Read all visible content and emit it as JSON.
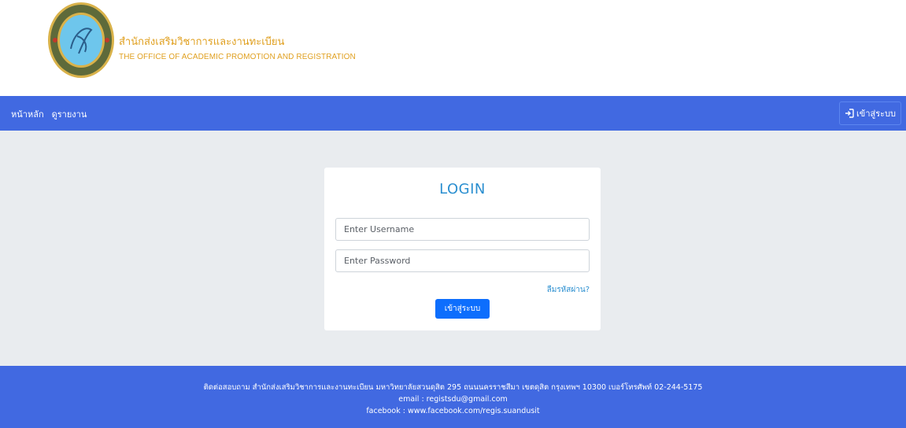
{
  "header": {
    "brand_th": "สำนักส่งเสริมวิชาการและงานทะเบียน",
    "brand_en": "THE OFFICE OF ACADEMIC PROMOTION AND REGISTRATION",
    "logo_icon": "suan-dusit-university-seal-icon"
  },
  "nav": {
    "items": [
      {
        "label": "หน้าหลัก"
      },
      {
        "label": "ดูรายงาน"
      }
    ],
    "login_label": "เข้าสู่ระบบ",
    "login_icon": "sign-in-icon"
  },
  "login": {
    "title": "LOGIN",
    "username_placeholder": "Enter Username",
    "password_placeholder": "Enter Password",
    "forgot_label": "ลืมรหัสผ่าน?",
    "submit_label": "เข้าสู่ระบบ"
  },
  "footer": {
    "contact": "ติดต่อสอบถาม สำนักส่งเสริมวิชาการและงานทะเบียน มหาวิทยาลัยสวนดุสิต 295 ถนนนครราชสีมา เขตดุสิต กรุงเทพฯ 10300 เบอร์โทรศัพท์ 02-244-5175",
    "email": "email : registsdu@gmail.com",
    "facebook": "facebook : www.facebook.com/regis.suandusit"
  },
  "colors": {
    "primary": "#4169e1",
    "brand_gold": "#e0a020",
    "link_blue": "#2b8fd0",
    "button_blue": "#0d6efd",
    "page_bg": "#e9ecef"
  }
}
